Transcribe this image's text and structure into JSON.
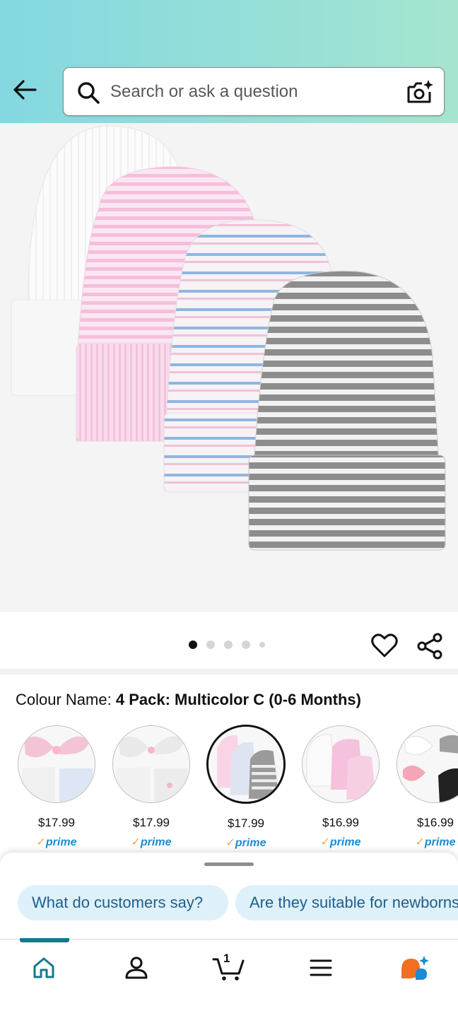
{
  "header": {
    "back_icon": "arrow-left-icon",
    "search": {
      "placeholder": "Search or ask a question",
      "search_icon": "search-icon",
      "camera_icon": "camera-sparkle-icon"
    }
  },
  "product": {
    "gallery": {
      "page_count": 5,
      "active_page": 1
    },
    "wishlist_icon": "heart-icon",
    "share_icon": "share-icon"
  },
  "colour": {
    "label": "Colour Name: ",
    "value": "4 Pack: Multicolor C (0-6 Months)",
    "options": [
      {
        "price": "$17.99",
        "prime": "prime",
        "selected": false
      },
      {
        "price": "$17.99",
        "prime": "prime",
        "selected": false
      },
      {
        "price": "$17.99",
        "prime": "prime",
        "selected": true
      },
      {
        "price": "$16.99",
        "prime": "prime",
        "selected": false
      },
      {
        "price": "$16.99",
        "prime": "prime",
        "selected": false
      }
    ]
  },
  "questions": {
    "chips": [
      "What do customers say?",
      "Are they suitable for newborns?"
    ]
  },
  "bottom_nav": {
    "items": [
      "home-icon",
      "account-icon",
      "cart-icon",
      "menu-icon",
      "rufus-icon"
    ],
    "cart_count": "1",
    "active": "home"
  },
  "colors": {
    "header_gradient_start": "#84d8e1",
    "header_gradient_end": "#a5e5cf",
    "chip_bg": "#def1fb",
    "chip_text": "#1d5e8c",
    "prime_blue": "#1b8bd3",
    "nav_active": "#127a8a"
  }
}
